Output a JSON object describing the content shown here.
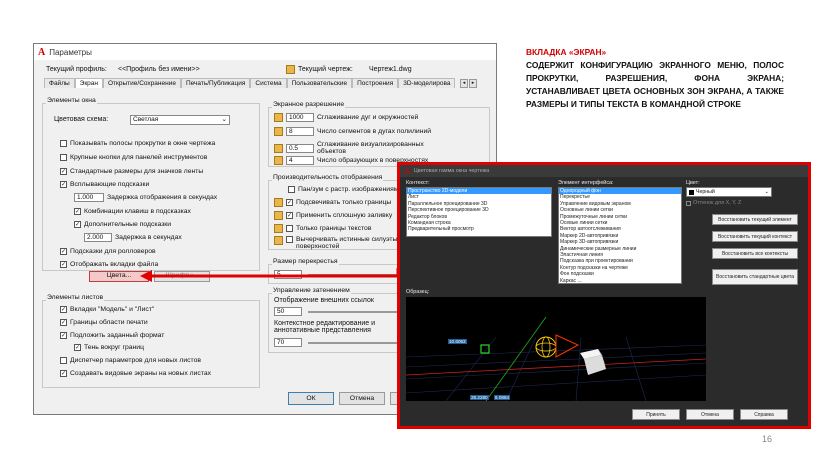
{
  "options_dialog": {
    "title": "Параметры",
    "current_profile_label": "Текущий профиль:",
    "current_profile_value": "<<Профиль без имени>>",
    "current_drawing_label": "Текущий чертеж:",
    "current_drawing_value": "Чертеж1.dwg",
    "tabs": [
      "Файлы",
      "Экран",
      "Открытие/Сохранение",
      "Печать/Публикация",
      "Система",
      "Пользовательские",
      "Построения",
      "3D-моделирова"
    ],
    "window_elements": {
      "title": "Элементы окна",
      "color_scheme_label": "Цветовая схема:",
      "color_scheme_value": "Светлая",
      "options": [
        {
          "label": "Показывать полосы прокрутки в окне чертежа",
          "checked": false
        },
        {
          "label": "Крупные кнопки для панелей инструментов",
          "checked": false
        },
        {
          "label": "Стандартные размеры для значков ленты",
          "checked": true
        },
        {
          "label": "Всплывающие подсказки",
          "checked": true
        }
      ],
      "tooltip_delay_value": "1.000",
      "tooltip_delay_label": "Задержка отображения в секундах",
      "shortcut_keys_label": "Комбинации клавиш в подсказках",
      "extended_tooltips_label": "Дополнительные подсказки",
      "extended_delay_value": "2.000",
      "extended_delay_label": "Задержка в секундах",
      "rollover_label": "Подсказки для ролловеров",
      "file_tabs_label": "Отображать вкладки файла",
      "colors_button": "Цвета...",
      "fonts_button": "Шрифты..."
    },
    "layout_elements": {
      "title": "Элементы листов",
      "options": [
        {
          "label": "Вкладки \"Модель\" и \"Лист\"",
          "checked": true
        },
        {
          "label": "Границы области печати",
          "checked": true
        },
        {
          "label": "Подложить заданный формат",
          "checked": true
        },
        {
          "label": "Тень вокруг границ",
          "checked": true
        },
        {
          "label": "Диспетчер параметров для новых листов",
          "checked": false
        },
        {
          "label": "Создавать видовые экраны на новых листах",
          "checked": true
        }
      ]
    },
    "display_resolution": {
      "title": "Экранное разрешение",
      "items": [
        {
          "value": "1000",
          "label": "Сглаживание дуг и окружностей"
        },
        {
          "value": "8",
          "label": "Число сегментов в дугах полилиний"
        },
        {
          "value": "0.5",
          "label": "Сглаживание визуализированных объектов"
        },
        {
          "value": "4",
          "label": "Число образующих в поверхностях"
        }
      ]
    },
    "display_performance": {
      "title": "Производительность отображения",
      "options": [
        {
          "label": "Пан/зум с растр. изображениями",
          "checked": false
        },
        {
          "label": "Подсвечивать только границы",
          "checked": true
        },
        {
          "label": "Применить сплошную заливку",
          "checked": true
        },
        {
          "label": "Только границы текстов",
          "checked": false
        },
        {
          "label": "Вычерчивать истинные силуэты поверхностей",
          "checked": false
        }
      ]
    },
    "crosshair": {
      "title": "Размер перекрестья",
      "value": "5"
    },
    "fade_control": {
      "title": "Управление затенением",
      "xref_label": "Отображение внешних ссылок",
      "xref_value": "50",
      "inplace_label": "Контекстное редактирование и аннотативные представления",
      "inplace_value": "70"
    },
    "buttons": {
      "ok": "ОК",
      "cancel": "Отмена",
      "apply": "При"
    }
  },
  "color_dialog": {
    "title": "Цветовая гамма окна чертежа",
    "context_label": "Контекст:",
    "contexts": [
      "Пространство 2D-модели",
      "Лист",
      "Параллельное проецирование 3D",
      "Перспективное проецирование 3D",
      "Редактор блоков",
      "Командная строка",
      "Предварительный просмотр"
    ],
    "element_label": "Элемент интерфейса:",
    "elements": [
      "Однородный фон",
      "Перекрестье",
      "Управление видовым экраном",
      "Основные линии сетки",
      "Промежуточные линии сетки",
      "Осевые линии сетки",
      "Вектор автоотслеживания",
      "Маркер 2D-автопривязки",
      "Маркер 3D-автопривязки",
      "Динамические размерные линии",
      "Эластичная линия",
      "Подсказка при проектировании",
      "Контур подсказки на чертеже",
      "Фон подсказки",
      "Каркас ..."
    ],
    "color_label": "Цвет:",
    "color_value": "Черный",
    "tint_label": "Оттенок для X, Y, Z",
    "side_buttons": [
      "Восстановить текущий элемент",
      "Восстановить текущий контекст",
      "Восстановить все контексты",
      "Восстановить стандартные цвета"
    ],
    "preview_label": "Образец:",
    "preview_values": [
      "10.6063",
      "28.2280",
      "6.0884"
    ],
    "buttons": {
      "apply": "Принять",
      "cancel": "Отмена",
      "help": "Справка"
    }
  },
  "annotation": {
    "heading": "ВКЛАДКА «ЭКРАН»",
    "body": "СОДЕРЖИТ КОНФИГУРАЦИЮ ЭКРАННОГО МЕНЮ, ПОЛОС ПРОКРУТКИ, РАЗРЕШЕНИЯ, ФОНА ЭКРАНА; УСТАНАВЛИВАЕТ ЦВЕТА ОСНОВНЫХ ЗОН ЭКРАНА, А ТАКЖЕ РАЗМЕРЫ И ТИПЫ ТЕКСТА В КОМАНДНОЙ СТРОКЕ"
  },
  "page_number": "16",
  "colors": {
    "accent_red": "#d00000",
    "selection_blue": "#3399ff"
  }
}
